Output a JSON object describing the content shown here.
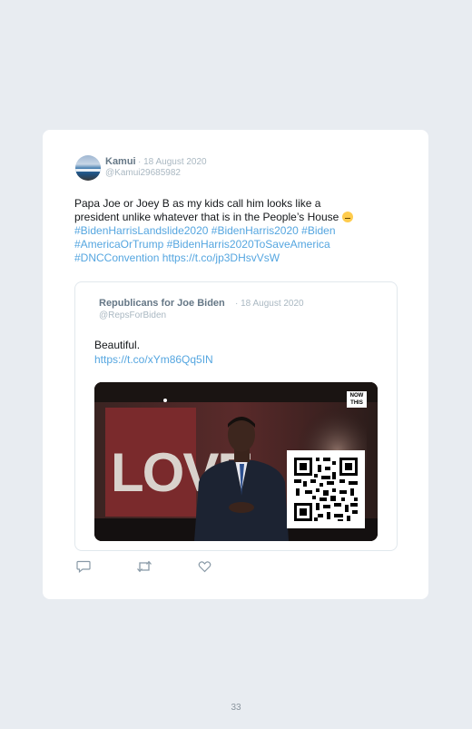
{
  "tweet": {
    "author_name": "Kamui",
    "date": "· 18 August 2020",
    "handle": "@Kamui29685982",
    "text_line1": "Papa Joe or Joey B as my kids call him looks like a",
    "text_line2": "president unlike whatever that is in the People’s House",
    "hashtags_line1": "#BidenHarrisLandslide2020 #BidenHarris2020 #Biden",
    "hashtags_line2": "#AmericaOrTrump #BidenHarris2020ToSaveAmerica",
    "hashtags_line3": "#DNCConvention https://t.co/jp3DHsvVsW"
  },
  "quoted": {
    "author_name": "Republicans for Joe Biden",
    "date": "· 18 August 2020",
    "handle": "@RepsForBiden",
    "text": "Beautiful.",
    "link": "https://t.co/xYm86Qq5IN",
    "media": {
      "sign_text": "LOVE",
      "badge_line1": "NOW",
      "badge_line2": "THIS"
    }
  },
  "actions": {
    "reply_icon": "reply-icon",
    "retweet_icon": "retweet-icon",
    "like_icon": "like-icon"
  },
  "page": {
    "number": "33"
  },
  "colors": {
    "page_background": "#e8ecf1",
    "link": "#55a6e0",
    "muted": "#aab8c2",
    "name": "#657786"
  }
}
